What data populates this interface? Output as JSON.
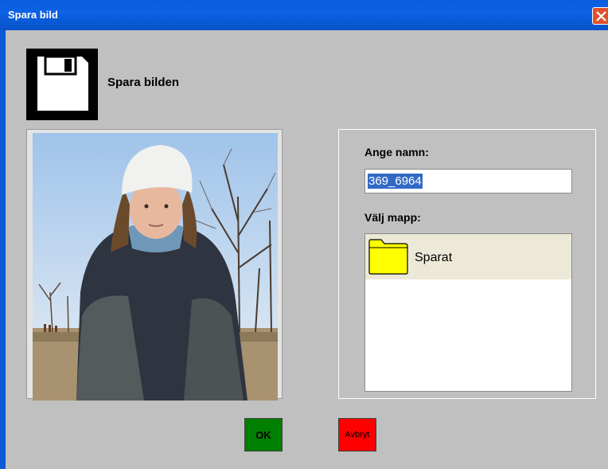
{
  "window": {
    "title": "Spara bild"
  },
  "header": {
    "label": "Spara bilden",
    "icon": "floppy-disk-icon"
  },
  "photo": {
    "description": "girl-in-white-hat-photo"
  },
  "form": {
    "name_label": "Ange namn:",
    "name_value": "369_6964",
    "folder_label": "Välj mapp:",
    "folders": [
      {
        "label": "Sparat",
        "icon": "folder-icon",
        "selected": true
      }
    ]
  },
  "buttons": {
    "ok_label": "OK",
    "cancel_label": "Avbryt"
  },
  "colors": {
    "titlebar": "#0a5fdc",
    "ok": "#008000",
    "cancel": "#ff0000",
    "selection": "#316ac5",
    "folder": "#ffff00"
  }
}
